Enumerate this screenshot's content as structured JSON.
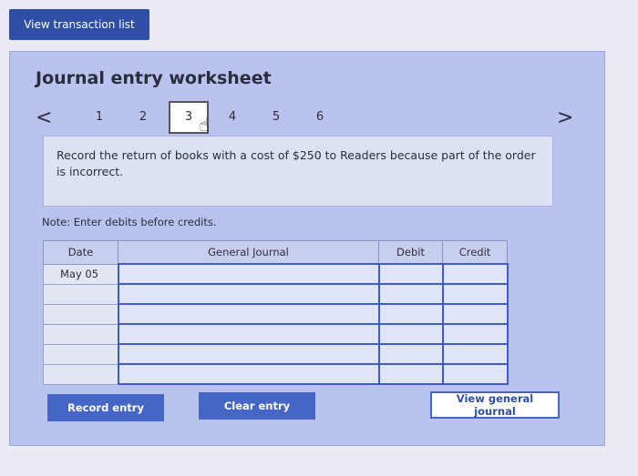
{
  "top_button": {
    "label": "View transaction list"
  },
  "worksheet": {
    "title": "Journal entry worksheet",
    "nav": {
      "prev": "<",
      "next": ">",
      "steps": [
        "1",
        "2",
        "3",
        "4",
        "5",
        "6"
      ],
      "active_step": "3"
    },
    "instruction": "Record the return of books with a cost of $250 to Readers because part of the order is incorrect.",
    "note": "Note: Enter debits before credits.",
    "table": {
      "headers": {
        "date": "Date",
        "journal": "General Journal",
        "debit": "Debit",
        "credit": "Credit"
      },
      "rows": [
        {
          "date": "May 05",
          "account": "",
          "debit": "",
          "credit": ""
        },
        {
          "date": "",
          "account": "",
          "debit": "",
          "credit": ""
        },
        {
          "date": "",
          "account": "",
          "debit": "",
          "credit": ""
        },
        {
          "date": "",
          "account": "",
          "debit": "",
          "credit": ""
        },
        {
          "date": "",
          "account": "",
          "debit": "",
          "credit": ""
        },
        {
          "date": "",
          "account": "",
          "debit": "",
          "credit": ""
        }
      ]
    },
    "buttons": {
      "record": "Record entry",
      "clear": "Clear entry",
      "view_journal": "View general journal"
    }
  },
  "colors": {
    "primary_button": "#2f4fa6",
    "panel": "#b9c3ee",
    "field_border": "#3f5bc9"
  },
  "icons": {
    "cursor": "hand-pointer-icon"
  }
}
